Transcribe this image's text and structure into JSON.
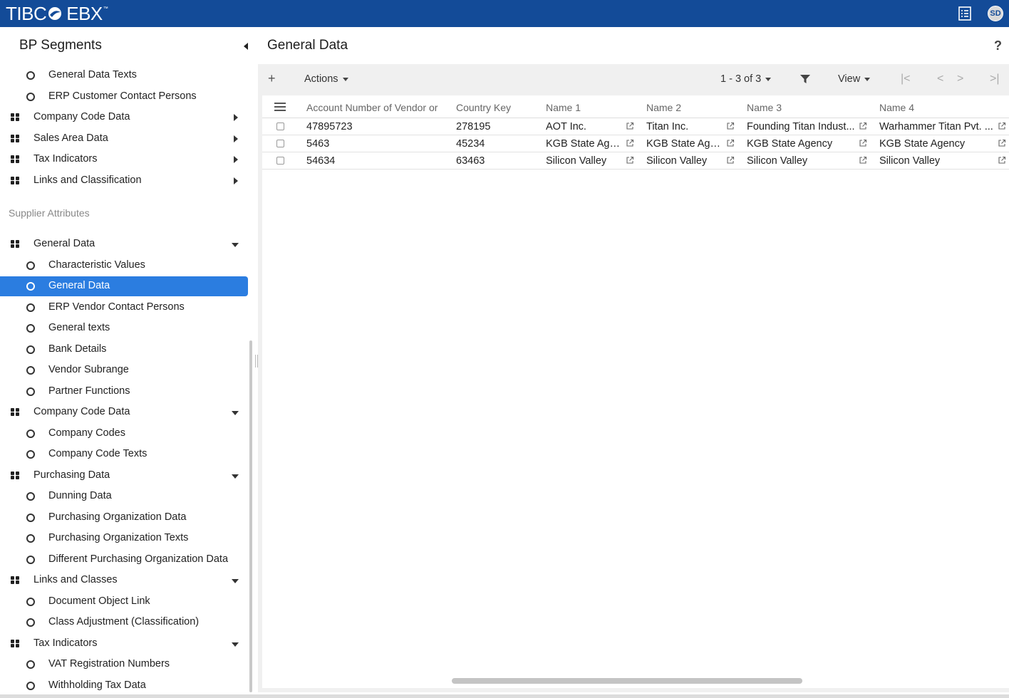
{
  "app": {
    "logo_left": "TIBC",
    "logo_right": "EBX",
    "logo_tm": "™",
    "user_initials": "SD"
  },
  "icons": {
    "logo_mark": "tibco-orb-icon",
    "topbar_list": "list-view-icon",
    "collapse": "caret-left-icon",
    "group": "grid-squares-icon",
    "table": "circle-icon",
    "add": "plus-icon",
    "filter": "filter-icon",
    "external": "open-external-icon",
    "columns_menu": "hamburger-icon"
  },
  "sidebar": {
    "title": "BP Segments",
    "section_label": "Supplier Attributes",
    "items_top": [
      {
        "type": "table",
        "label": "General Data Texts"
      },
      {
        "type": "table",
        "label": "ERP Customer Contact Persons"
      },
      {
        "type": "group",
        "label": "Company Code Data",
        "state": "collapsed"
      },
      {
        "type": "group",
        "label": "Sales Area Data",
        "state": "collapsed"
      },
      {
        "type": "group",
        "label": "Tax Indicators",
        "state": "collapsed"
      },
      {
        "type": "group",
        "label": "Links and Classification",
        "state": "collapsed"
      }
    ],
    "items_supplier": [
      {
        "type": "group",
        "label": "General Data",
        "state": "expanded"
      },
      {
        "type": "table",
        "label": "Characteristic Values"
      },
      {
        "type": "table",
        "label": "General Data",
        "selected": true
      },
      {
        "type": "table",
        "label": "ERP Vendor Contact Persons"
      },
      {
        "type": "table",
        "label": "General texts"
      },
      {
        "type": "table",
        "label": "Bank Details"
      },
      {
        "type": "table",
        "label": "Vendor Subrange"
      },
      {
        "type": "table",
        "label": "Partner Functions"
      },
      {
        "type": "group",
        "label": "Company Code Data",
        "state": "expanded"
      },
      {
        "type": "table",
        "label": "Company Codes"
      },
      {
        "type": "table",
        "label": "Company Code Texts"
      },
      {
        "type": "group",
        "label": "Purchasing Data",
        "state": "expanded"
      },
      {
        "type": "table",
        "label": "Dunning Data"
      },
      {
        "type": "table",
        "label": "Purchasing Organization Data"
      },
      {
        "type": "table",
        "label": "Purchasing Organization Texts"
      },
      {
        "type": "table",
        "label": "Different Purchasing Organization Data"
      },
      {
        "type": "group",
        "label": "Links and Classes",
        "state": "expanded"
      },
      {
        "type": "table",
        "label": "Document Object Link"
      },
      {
        "type": "table",
        "label": "Class Adjustment (Classification)"
      },
      {
        "type": "group",
        "label": "Tax Indicators",
        "state": "expanded"
      },
      {
        "type": "table",
        "label": "VAT Registration Numbers"
      },
      {
        "type": "table",
        "label": "Withholding Tax Data"
      }
    ]
  },
  "main": {
    "title": "General Data",
    "help": "?",
    "toolbar": {
      "add": "+",
      "actions": "Actions",
      "pagination": "1 - 3 of 3",
      "view": "View",
      "first": "|<",
      "prev": "<",
      "next": ">",
      "last": ">|"
    },
    "table": {
      "columns": [
        "Account Number of Vendor or",
        "Country Key",
        "Name 1",
        "Name 2",
        "Name 3",
        "Name 4"
      ],
      "rows": [
        [
          "47895723",
          "278195",
          "AOT Inc.",
          "Titan Inc.",
          "Founding Titan Indust...",
          "Warhammer Titan Pvt. ..."
        ],
        [
          "5463",
          "45234",
          "KGB State Age...",
          "KGB State Age...",
          "KGB State Agency",
          "KGB State Agency"
        ],
        [
          "54634",
          "63463",
          "Silicon Valley",
          "Silicon Valley",
          "Silicon Valley",
          "Silicon Valley"
        ]
      ]
    }
  },
  "colors": {
    "topbar": "#134b98",
    "selection": "#2b7de0"
  }
}
